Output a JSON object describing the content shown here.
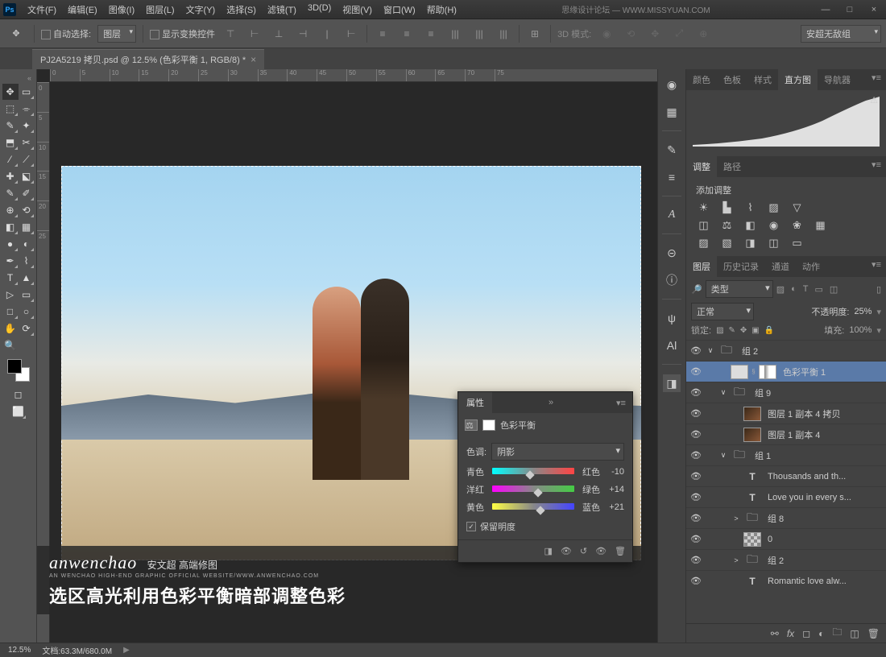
{
  "menu": [
    "文件(F)",
    "编辑(E)",
    "图像(I)",
    "图层(L)",
    "文字(Y)",
    "选择(S)",
    "滤镜(T)",
    "3D(D)",
    "视图(V)",
    "窗口(W)",
    "帮助(H)"
  ],
  "brand_banner": "思缘设计论坛 — WWW.MISSYUAN.COM",
  "options": {
    "auto_select": "自动选择:",
    "layer_dd": "图层",
    "show_transform": "显示变换控件",
    "mode_3d": "3D 模式:",
    "group_dd": "安超无敌组"
  },
  "doc_tab": "PJ2A5219 拷贝.psd @ 12.5% (色彩平衡 1, RGB/8) *",
  "ruler_h": [
    "0",
    "5",
    "10",
    "15",
    "20",
    "25",
    "30",
    "35",
    "40",
    "45",
    "50",
    "55",
    "60",
    "65",
    "70",
    "75"
  ],
  "ruler_v": [
    "0",
    "5",
    "10",
    "15",
    "20",
    "25"
  ],
  "annotation": {
    "brand": "anwenchao",
    "brand_sub": "安文超 高端修图",
    "brand_tiny": "AN WENCHAO HIGH-END GRAPHIC OFFICIAL WEBSITE/WWW.ANWENCHAO.COM",
    "text": "选区高光利用色彩平衡暗部调整色彩"
  },
  "right_tabs": {
    "histogram": [
      "颜色",
      "色板",
      "样式",
      "直方图",
      "导航器"
    ],
    "adjust": [
      "调整",
      "路径"
    ],
    "layers": [
      "图层",
      "历史记录",
      "通道",
      "动作"
    ]
  },
  "adjustments": {
    "title": "添加调整"
  },
  "layers_panel": {
    "filter_label": "类型",
    "blend_mode": "正常",
    "opacity_label": "不透明度:",
    "opacity_value": "25%",
    "lock_label": "锁定:",
    "fill_label": "填充:",
    "fill_value": "100%"
  },
  "layers": [
    {
      "eye": true,
      "indent": 0,
      "twist": "∨",
      "thumb": "folder",
      "name": "组 2"
    },
    {
      "eye": true,
      "indent": 1,
      "twist": "",
      "thumb": "adj",
      "mask": true,
      "name": "色彩平衡 1",
      "selected": true
    },
    {
      "eye": true,
      "indent": 1,
      "twist": "∨",
      "thumb": "folder",
      "name": "组 9"
    },
    {
      "eye": true,
      "indent": 2,
      "twist": "",
      "thumb": "img",
      "name": "图层 1 副本 4 拷贝"
    },
    {
      "eye": true,
      "indent": 2,
      "twist": "",
      "thumb": "img",
      "name": "图层 1 副本 4"
    },
    {
      "eye": true,
      "indent": 1,
      "twist": "∨",
      "thumb": "folder",
      "name": "组 1"
    },
    {
      "eye": true,
      "indent": 2,
      "twist": "",
      "thumb": "text",
      "name": "Thousands and th..."
    },
    {
      "eye": true,
      "indent": 2,
      "twist": "",
      "thumb": "text",
      "name": "Love you in every s..."
    },
    {
      "eye": true,
      "indent": 2,
      "twist": ">",
      "thumb": "folder",
      "name": "组 8"
    },
    {
      "eye": true,
      "indent": 2,
      "twist": "",
      "thumb": "checker",
      "name": "0"
    },
    {
      "eye": true,
      "indent": 2,
      "twist": ">",
      "thumb": "folder",
      "name": "组 2"
    },
    {
      "eye": true,
      "indent": 2,
      "twist": "",
      "thumb": "text",
      "name": "Romantic love  alw..."
    }
  ],
  "properties": {
    "tab": "属性",
    "title": "色彩平衡",
    "tone_label": "色调:",
    "tone_value": "阴影",
    "sliders": [
      {
        "left": "青色",
        "right": "红色",
        "value": -10,
        "pos": 46,
        "grad": "grad-cr"
      },
      {
        "left": "洋红",
        "right": "绿色",
        "value": 14,
        "pos": 56,
        "grad": "grad-mg"
      },
      {
        "left": "黄色",
        "right": "蓝色",
        "value": 21,
        "pos": 59,
        "grad": "grad-yb"
      }
    ],
    "preserve": "保留明度"
  },
  "status": {
    "zoom": "12.5%",
    "doc_label": "文档:",
    "doc_value": "63.3M/680.0M"
  }
}
